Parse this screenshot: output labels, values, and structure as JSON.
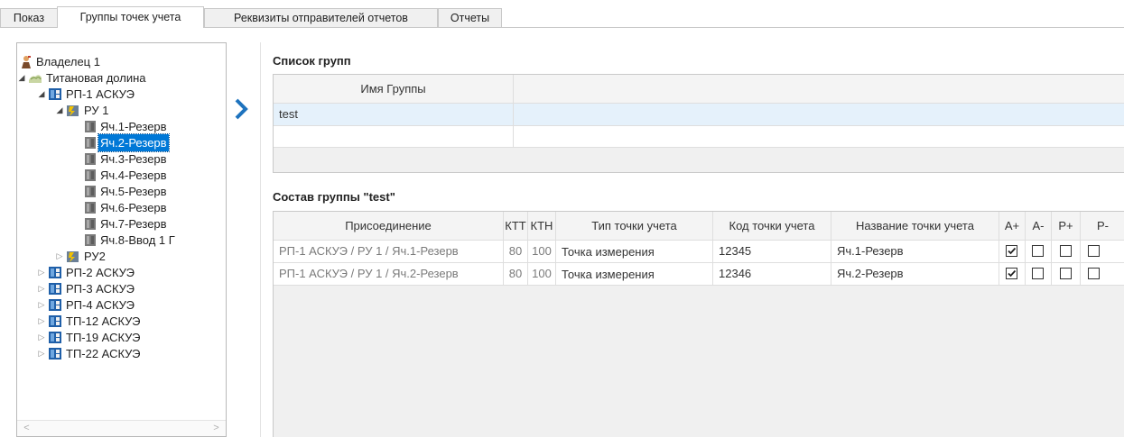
{
  "tabs": [
    {
      "label": "Показ",
      "active": false
    },
    {
      "label": "Группы точек учета",
      "active": true
    },
    {
      "label": "Реквизиты отправителей отчетов",
      "active": false
    },
    {
      "label": "Отчеты",
      "active": false
    }
  ],
  "tree": {
    "owner": "Владелец 1",
    "site": "Титановая долина",
    "rp1": "РП-1 АСКУЭ",
    "ru1": "РУ 1",
    "cells": [
      "Яч.1-Резерв",
      "Яч.2-Резерв",
      "Яч.3-Резерв",
      "Яч.4-Резерв",
      "Яч.5-Резерв",
      "Яч.6-Резерв",
      "Яч.7-Резерв",
      "Яч.8-Ввод 1 Г"
    ],
    "ru2": "РУ2",
    "stations": [
      "РП-2 АСКУЭ",
      "РП-3 АСКУЭ",
      "РП-4 АСКУЭ",
      "ТП-12 АСКУЭ",
      "ТП-19 АСКУЭ",
      "ТП-22 АСКУЭ"
    ],
    "selected": "Яч.2-Резерв"
  },
  "groups": {
    "title": "Список групп",
    "column": "Имя Группы",
    "rows": [
      "test"
    ]
  },
  "composition": {
    "title": "Состав группы \"test\"",
    "columns": [
      "Присоединение",
      "КТТ",
      "КТН",
      "Тип точки учета",
      "Код точки учета",
      "Название точки учета",
      "А+",
      "А-",
      "Р+",
      "Р-"
    ],
    "rows": [
      {
        "connection": "РП-1 АСКУЭ / РУ 1 / Яч.1-Резерв",
        "ktt": "80",
        "ktn": "100",
        "type": "Точка измерения",
        "code": "12345",
        "name": "Яч.1-Резерв",
        "a_plus": true,
        "a_minus": false,
        "r_plus": false,
        "r_minus": false
      },
      {
        "connection": "РП-1 АСКУЭ / РУ 1 / Яч.2-Резерв",
        "ktt": "80",
        "ktn": "100",
        "type": "Точка измерения",
        "code": "12346",
        "name": "Яч.2-Резерв",
        "a_plus": true,
        "a_minus": false,
        "r_plus": false,
        "r_minus": false
      }
    ]
  },
  "icons": {
    "owner": "person-icon",
    "site": "region-icon",
    "station": "substation-icon",
    "switchgear": "switchgear-icon",
    "cell": "cell-icon",
    "expand_arrow": "chevron-right-icon"
  },
  "colors": {
    "selection": "#0078d7",
    "accent_arrow": "#1e73be",
    "row_selected": "#e5f1fb"
  }
}
